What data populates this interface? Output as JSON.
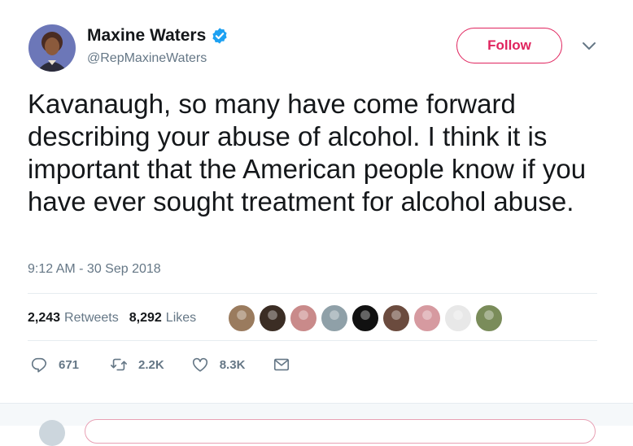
{
  "author": {
    "name": "Maxine Waters",
    "handle": "@RepMaxineWaters",
    "avatar_icon": "user-avatar",
    "verified_icon": "verified-badge-icon"
  },
  "follow_button": {
    "label": "Follow"
  },
  "tweet": {
    "text": "Kavanaugh, so many have come forward describing your abuse of alcohol. I think it is important that the American people know if you have ever sought treatment for alcohol abuse.",
    "timestamp": "9:12 AM - 30 Sep 2018"
  },
  "stats": {
    "retweets_count": "2,243",
    "retweets_label": "Retweets",
    "likes_count": "8,292",
    "likes_label": "Likes"
  },
  "liker_avatars": [
    {
      "icon": "liker-avatar-1",
      "color": "#9a7b5e"
    },
    {
      "icon": "liker-avatar-2",
      "color": "#3b2d24"
    },
    {
      "icon": "liker-avatar-3",
      "color": "#c98a8a"
    },
    {
      "icon": "liker-avatar-4",
      "color": "#8fa0a8"
    },
    {
      "icon": "liker-avatar-5",
      "color": "#111111"
    },
    {
      "icon": "liker-avatar-6",
      "color": "#6b4b3e"
    },
    {
      "icon": "liker-avatar-7",
      "color": "#d69aa0"
    },
    {
      "icon": "liker-avatar-8",
      "color": "#e8e8e8"
    },
    {
      "icon": "liker-avatar-9",
      "color": "#7a8c5a"
    }
  ],
  "actions": {
    "reply_count": "671",
    "retweet_count": "2.2K",
    "like_count": "8.3K"
  },
  "colors": {
    "follow_accent": "#e0245e",
    "verified_blue": "#1da1f2",
    "secondary_text": "#657786"
  }
}
